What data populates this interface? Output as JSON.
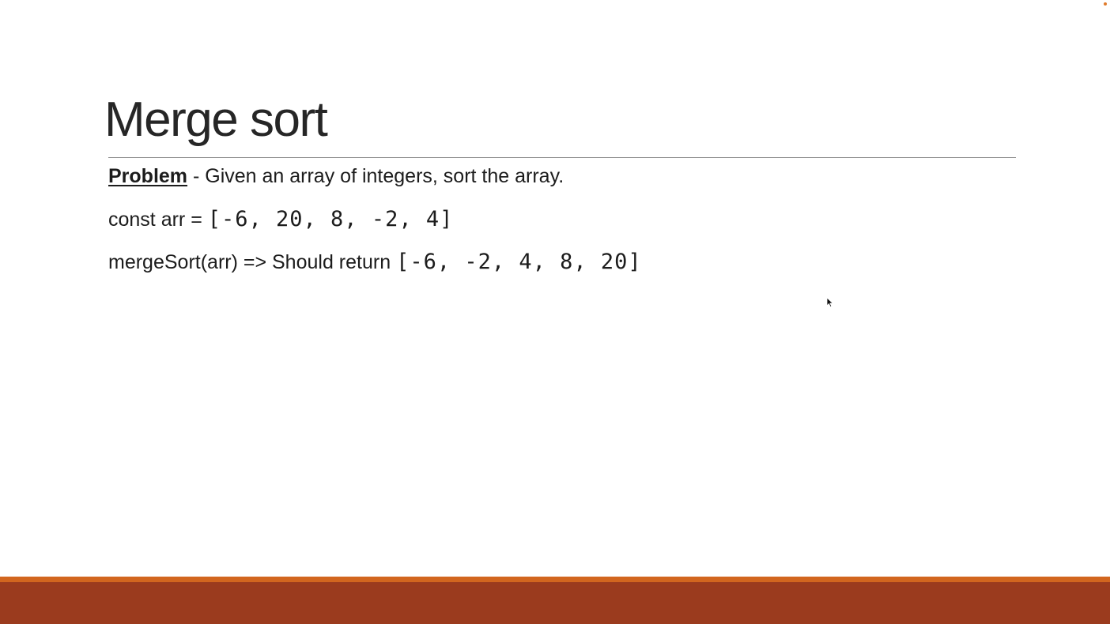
{
  "slide": {
    "title": "Merge sort",
    "problem_label": "Problem",
    "problem_text": " - Given an array of integers, sort the array.",
    "line2_prefix": "const arr = ",
    "line2_code": "[-6, 20, 8, -2, 4]",
    "line3_prefix": "mergeSort(arr) => Should return ",
    "line3_code": "[-6, -2, 4, 8, 20]"
  },
  "theme": {
    "footer_accent_color": "#d2661f",
    "footer_bar_color": "#9b3b1e",
    "rule_color": "#8c8c8c"
  },
  "cursor": {
    "icon": "mouse-pointer-icon"
  }
}
